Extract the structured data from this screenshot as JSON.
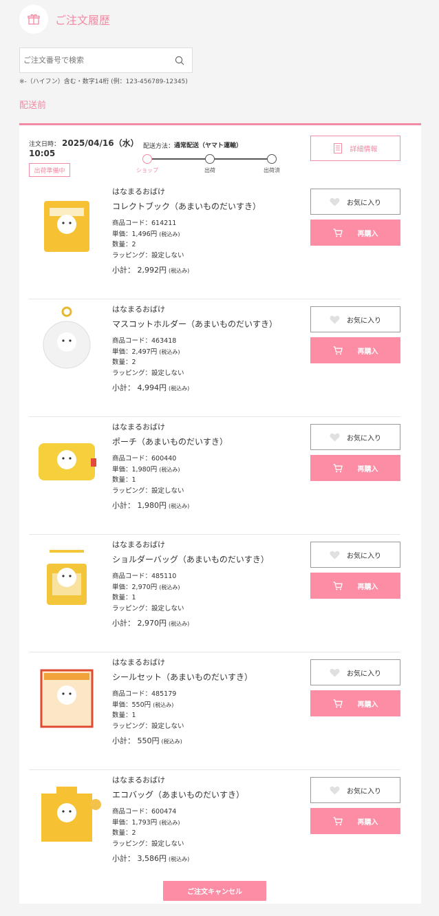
{
  "header": {
    "title": "ご注文履歴",
    "icon": "gift-icon"
  },
  "search": {
    "placeholder": "ご注文番号で検索",
    "value": "",
    "hint": "※-（ハイフン）含む・数字14桁 (例：123-456789-12345)"
  },
  "section_title": "配送前",
  "order": {
    "date_label": "注文日時：",
    "date": "2025/04/16（水）",
    "time": "10:05",
    "status": "出荷準備中",
    "shipping_label": "配送方法：",
    "shipping_method": "通常配送（ヤマト運輸）",
    "steps": [
      "ショップ",
      "出荷",
      "出荷済"
    ],
    "active_step": 0,
    "detail_button": "詳細情報",
    "cancel_button": "ご注文キャンセル"
  },
  "labels": {
    "code": "商品コード：",
    "unit_price": "単価：",
    "quantity": "数量：",
    "wrapping": "ラッピング：",
    "subtotal": "小計：",
    "tax_included": "(税込み)",
    "favorite": "お気に入り",
    "rebuy": "再購入"
  },
  "items": [
    {
      "brand": "はなまるおばけ",
      "name": "コレクトブック（あまいものだいすき）",
      "code": "614211",
      "unit_price": "1,496円",
      "quantity": "2",
      "wrapping": "設定しない",
      "subtotal": "2,992円",
      "color": "#f6c233"
    },
    {
      "brand": "はなまるおばけ",
      "name": "マスコットホルダー（あまいものだいすき）",
      "code": "463418",
      "unit_price": "2,497円",
      "quantity": "2",
      "wrapping": "設定しない",
      "subtotal": "4,994円",
      "color": "#f4f4f4"
    },
    {
      "brand": "はなまるおばけ",
      "name": "ポーチ（あまいものだいすき）",
      "code": "600440",
      "unit_price": "1,980円",
      "quantity": "1",
      "wrapping": "設定しない",
      "subtotal": "1,980円",
      "color": "#f6cf3c"
    },
    {
      "brand": "はなまるおばけ",
      "name": "ショルダーバッグ（あまいものだいすき）",
      "code": "485110",
      "unit_price": "2,970円",
      "quantity": "1",
      "wrapping": "設定しない",
      "subtotal": "2,970円",
      "color": "#f3c53a"
    },
    {
      "brand": "はなまるおばけ",
      "name": "シールセット（あまいものだいすき）",
      "code": "485179",
      "unit_price": "550円",
      "quantity": "1",
      "wrapping": "設定しない",
      "subtotal": "550円",
      "color": "#f2a23a"
    },
    {
      "brand": "はなまるおばけ",
      "name": "エコバッグ（あまいものだいすき）",
      "code": "600474",
      "unit_price": "1,793円",
      "quantity": "2",
      "wrapping": "設定しない",
      "subtotal": "3,586円",
      "color": "#f6c233"
    }
  ]
}
